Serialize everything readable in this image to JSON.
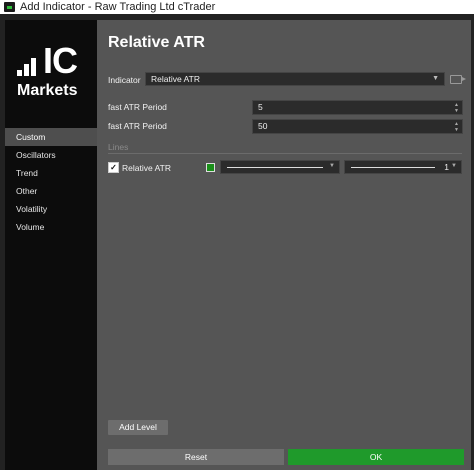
{
  "window": {
    "title": "Add Indicator - Raw Trading Ltd cTrader"
  },
  "logo": {
    "ic": "IC",
    "markets": "Markets"
  },
  "sidebar": {
    "items": [
      {
        "label": "Custom",
        "active": true
      },
      {
        "label": "Oscillators"
      },
      {
        "label": "Trend"
      },
      {
        "label": "Other"
      },
      {
        "label": "Volatility"
      },
      {
        "label": "Volume"
      }
    ]
  },
  "main": {
    "title": "Relative ATR",
    "indicator_label": "Indicator",
    "indicator_value": "Relative ATR",
    "params": [
      {
        "label": "fast ATR Period",
        "value": "5"
      },
      {
        "label": "fast ATR Period",
        "value": "50"
      }
    ],
    "lines_section": "Lines",
    "line": {
      "name": "Relative ATR",
      "checked": "✓",
      "color": "#1a8f1a",
      "width": "1"
    },
    "add_level": "Add Level",
    "reset": "Reset",
    "ok": "OK"
  },
  "colors": {
    "accent_green": "#1f9a2b",
    "panel": "#555555",
    "sidebar": "#0c0c0c"
  }
}
